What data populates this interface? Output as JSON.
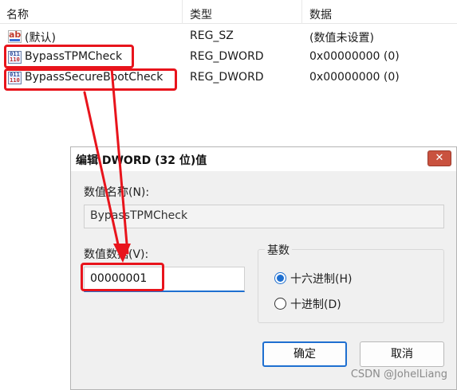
{
  "registry": {
    "columns": {
      "name": "名称",
      "type": "类型",
      "data": "数据"
    },
    "rows": [
      {
        "icon": "string-value-icon",
        "name": "(默认)",
        "type": "REG_SZ",
        "data": "(数值未设置)"
      },
      {
        "icon": "binary-value-icon",
        "name": "BypassTPMCheck",
        "type": "REG_DWORD",
        "data": "0x00000000 (0)"
      },
      {
        "icon": "binary-value-icon",
        "name": "BypassSecureBootCheck",
        "type": "REG_DWORD",
        "data": "0x00000000 (0)"
      }
    ]
  },
  "dialog": {
    "title": "编辑 DWORD (32 位)值",
    "close_glyph": "✕",
    "value_name_label": "数值名称(N):",
    "value_name": "BypassTPMCheck",
    "value_data_label": "数值数据(V):",
    "value_data": "00000001",
    "base_label": "基数",
    "base_options": [
      {
        "label": "十六进制(H)",
        "checked": true
      },
      {
        "label": "十进制(D)",
        "checked": false
      }
    ],
    "ok_label": "确定",
    "cancel_label": "取消"
  },
  "icon_glyphs": {
    "string_icon_text": "ab",
    "binary_icon_top": "011",
    "binary_icon_bottom": "110"
  },
  "annotation_color": "#e8141c",
  "accent_color": "#1e6fd0",
  "watermark": "CSDN @JohelLiang"
}
